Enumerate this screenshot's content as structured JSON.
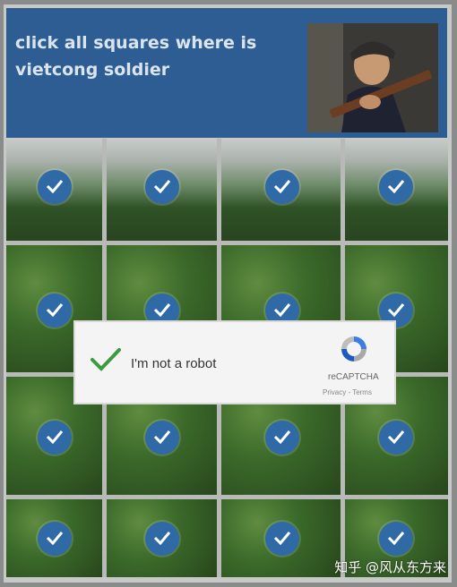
{
  "header": {
    "instruction": "click all squares where is vietcong soldier"
  },
  "captcha": {
    "label": "I'm not a robot",
    "brand": "reCAPTCHA",
    "links": "Privacy - Terms",
    "checked": true
  },
  "grid": {
    "rows": 4,
    "columns": 4,
    "selected_count": 16
  },
  "watermark": "知乎 @风从东方来",
  "colors": {
    "header_bg": "#2d5d92",
    "check_bg": "#2f6aa6",
    "captcha_check": "#3c9a3f"
  }
}
